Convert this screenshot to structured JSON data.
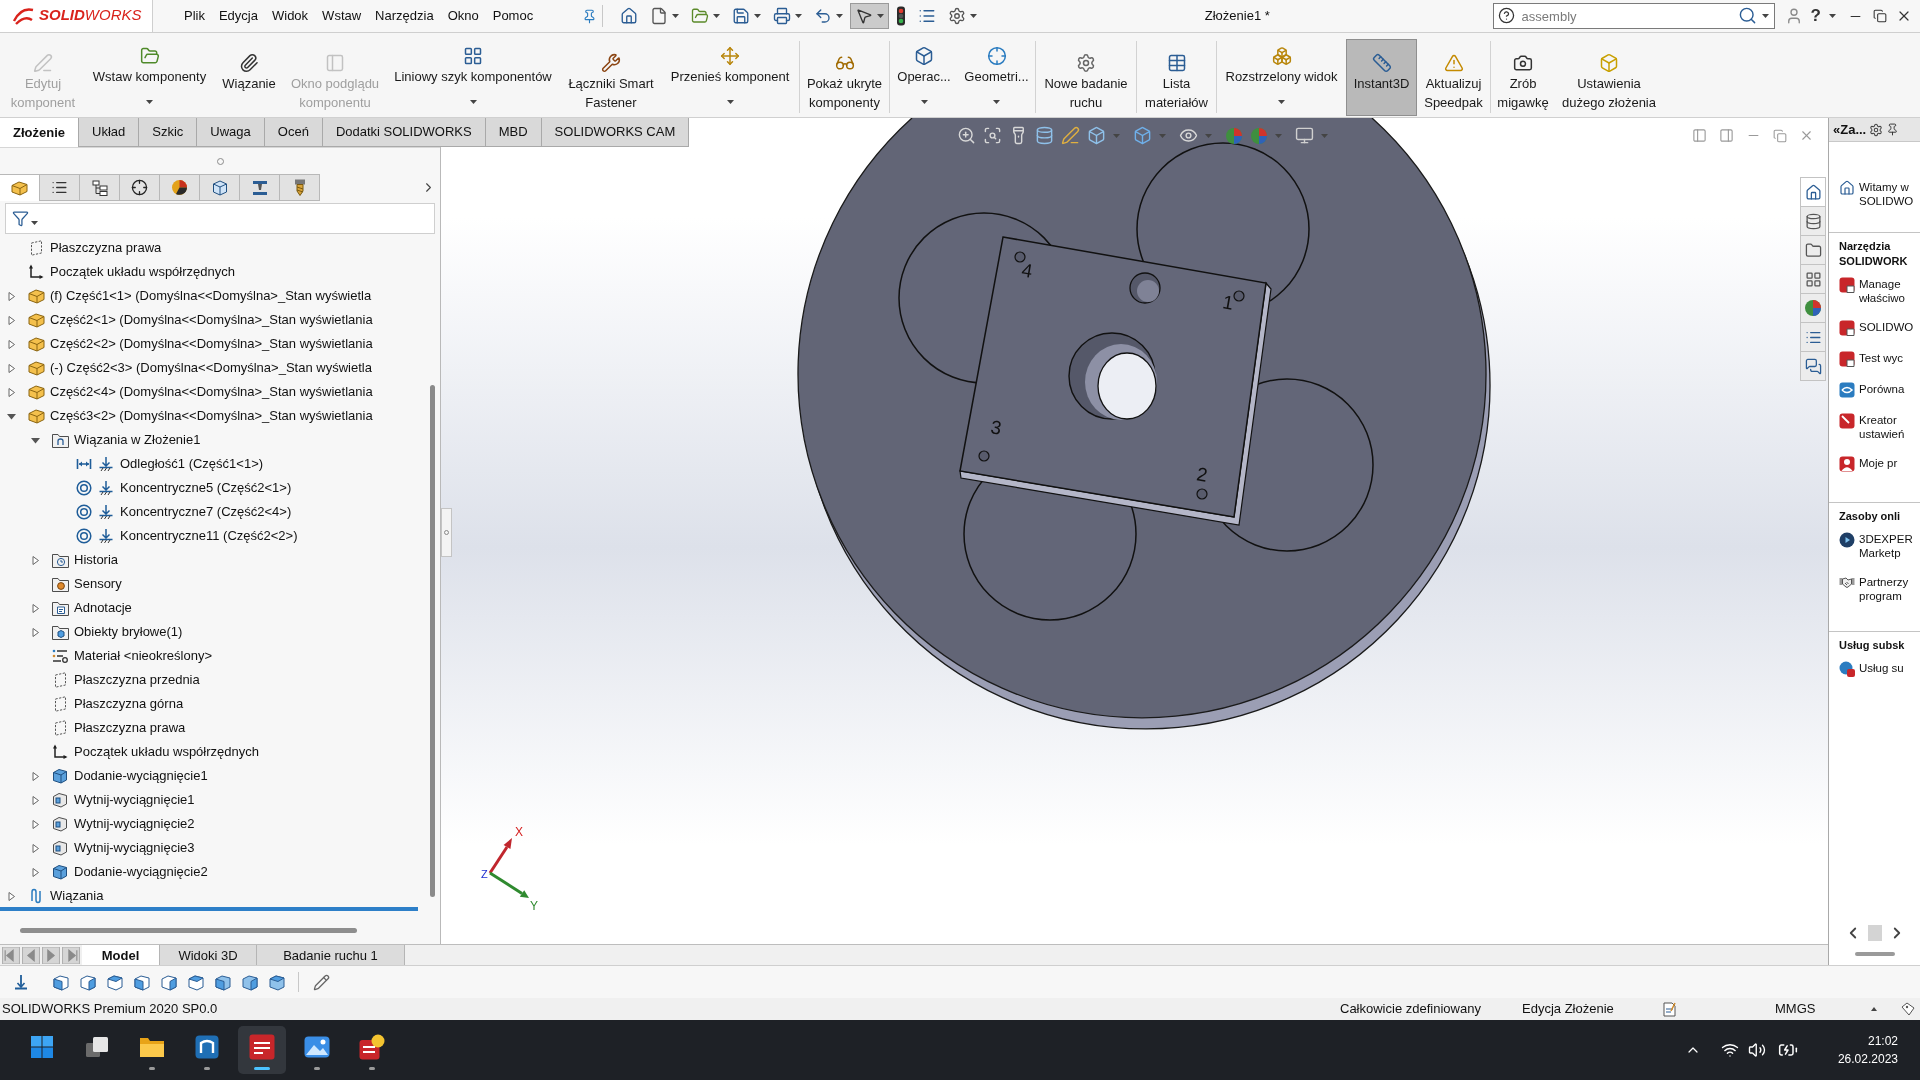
{
  "app": {
    "logo_text": "**SOLID**WORKS",
    "menu": [
      "Plik",
      "Edycja",
      "Widok",
      "Wstaw",
      "Narzędzia",
      "Okno",
      "Pomoc"
    ],
    "quick_access": [
      {
        "dropdown": false,
        "pressed": false
      },
      {
        "dropdown": true,
        "pressed": false
      },
      {
        "dropdown": true,
        "pressed": false
      },
      {
        "dropdown": true,
        "pressed": false
      },
      {
        "dropdown": true,
        "pressed": false
      },
      {
        "dropdown": true,
        "pressed": false
      },
      {
        "dropdown": true,
        "pressed": true
      },
      {
        "dropdown": false,
        "pressed": false
      },
      {
        "dropdown": false,
        "pressed": false
      },
      {
        "dropdown": true,
        "pressed": false
      }
    ],
    "title": "Złożenie1 *",
    "search": {
      "placeholder": "assembly"
    },
    "help_label": "?"
  },
  "ribbon": {
    "groups": [
      [
        {
          "label": "Edytuj komponent",
          "disabled": true,
          "dropdown": false,
          "on": false
        },
        {
          "label": "Wstaw komponenty",
          "disabled": false,
          "dropdown": true,
          "on": false
        },
        {
          "label": "Wiązanie",
          "disabled": false,
          "dropdown": false,
          "on": false
        },
        {
          "label": "Okno podglądu komponentu",
          "disabled": true,
          "dropdown": false,
          "on": false
        },
        {
          "label": "Liniowy szyk komponentów",
          "disabled": false,
          "dropdown": true,
          "on": false
        },
        {
          "label": "Łączniki Smart Fastener",
          "disabled": false,
          "dropdown": false,
          "on": false
        },
        {
          "label": "Przenieś komponent",
          "disabled": false,
          "dropdown": true,
          "on": false
        }
      ],
      [
        {
          "label": "Pokaż ukryte komponenty",
          "disabled": false,
          "dropdown": false,
          "on": false
        }
      ],
      [
        {
          "label": "Operac...",
          "disabled": false,
          "dropdown": true,
          "on": false
        },
        {
          "label": "Geometri...",
          "disabled": false,
          "dropdown": true,
          "on": false
        }
      ],
      [
        {
          "label": "Nowe badanie ruchu",
          "disabled": false,
          "dropdown": false,
          "on": false
        }
      ],
      [
        {
          "label": "Lista materiałów",
          "disabled": false,
          "dropdown": false,
          "on": false
        }
      ],
      [
        {
          "label": "Rozstrzelony widok",
          "disabled": false,
          "dropdown": true,
          "on": false
        },
        {
          "label": "Instant3D",
          "disabled": false,
          "dropdown": false,
          "on": true
        },
        {
          "label": "Aktualizuj Speedpak",
          "disabled": false,
          "dropdown": false,
          "on": false
        }
      ],
      [
        {
          "label": "Zrób migawkę",
          "disabled": false,
          "dropdown": false,
          "on": false
        },
        {
          "label": "Ustawienia dużego złożenia",
          "disabled": false,
          "dropdown": false,
          "on": false
        }
      ]
    ]
  },
  "command_tabs": [
    {
      "label": "Złożenie",
      "selected": true
    },
    {
      "label": "Układ",
      "selected": false
    },
    {
      "label": "Szkic",
      "selected": false
    },
    {
      "label": "Uwaga",
      "selected": false
    },
    {
      "label": "Oceń",
      "selected": false
    },
    {
      "label": "Dodatki SOLIDWORKS",
      "selected": false
    },
    {
      "label": "MBD",
      "selected": false
    },
    {
      "label": "SOLIDWORKS CAM",
      "selected": false
    }
  ],
  "feature_manager": {
    "panel_tabs": [
      {
        "selected": true
      },
      {
        "selected": false
      },
      {
        "selected": false
      },
      {
        "selected": false
      },
      {
        "selected": false
      },
      {
        "selected": false
      },
      {
        "selected": false
      },
      {
        "selected": false
      }
    ],
    "tree": [
      {
        "text": "Płaszczyzna prawa",
        "kind": "plane"
      },
      {
        "text": "Początek układu współrzędnych",
        "kind": "origin"
      },
      {
        "text": "(f) Część1<1> (Domyślna<<Domyślna>_Stan wyświetla",
        "kind": "part",
        "expanded": false
      },
      {
        "text": "Część2<1> (Domyślna<<Domyślna>_Stan wyświetlania",
        "kind": "part",
        "expanded": false
      },
      {
        "text": "Część2<2> (Domyślna<<Domyślna>_Stan wyświetlania",
        "kind": "part",
        "expanded": false
      },
      {
        "text": "(-) Część2<3> (Domyślna<<Domyślna>_Stan wyświetla",
        "kind": "part",
        "expanded": false
      },
      {
        "text": "Część2<4> (Domyślna<<Domyślna>_Stan wyświetlania",
        "kind": "part",
        "expanded": false
      },
      {
        "text": "Część3<2> (Domyślna<<Domyślna>_Stan wyświetlania",
        "kind": "part",
        "expanded": true,
        "children": [
          {
            "text": "Wiązania w Złożenie1",
            "kind": "mates_folder",
            "expanded": true,
            "children": [
              {
                "text": "Odległość1 (Część1<1>)",
                "kind": "distance_mate"
              },
              {
                "text": "Koncentryczne5 (Część2<1>)",
                "kind": "concentric_mate"
              },
              {
                "text": "Koncentryczne7 (Część2<4>)",
                "kind": "concentric_mate"
              },
              {
                "text": "Koncentryczne11 (Część2<2>)",
                "kind": "concentric_mate"
              }
            ]
          },
          {
            "text": "Historia",
            "kind": "history_folder",
            "expanded": false
          },
          {
            "text": "Sensory",
            "kind": "sensors_folder"
          },
          {
            "text": "Adnotacje",
            "kind": "annotations_folder",
            "expanded": false
          },
          {
            "text": "Obiekty bryłowe(1)",
            "kind": "bodies_folder",
            "expanded": false
          },
          {
            "text": "Materiał <nieokreślony>",
            "kind": "material"
          },
          {
            "text": "Płaszczyzna przednia",
            "kind": "plane"
          },
          {
            "text": "Płaszczyzna górna",
            "kind": "plane"
          },
          {
            "text": "Płaszczyzna prawa",
            "kind": "plane"
          },
          {
            "text": "Początek układu współrzędnych",
            "kind": "origin"
          },
          {
            "text": "Dodanie-wyciągnięcie1",
            "kind": "boss",
            "expanded": false
          },
          {
            "text": "Wytnij-wyciągnięcie1",
            "kind": "cut",
            "expanded": false
          },
          {
            "text": "Wytnij-wyciągnięcie2",
            "kind": "cut",
            "expanded": false
          },
          {
            "text": "Wytnij-wyciągnięcie3",
            "kind": "cut",
            "expanded": false
          },
          {
            "text": "Dodanie-wyciągnięcie2",
            "kind": "boss",
            "expanded": false
          }
        ]
      },
      {
        "text": "Wiązania",
        "kind": "mates",
        "expanded": false
      }
    ]
  },
  "viewport": {
    "plate_labels": [
      "4",
      "1",
      "3",
      "2"
    ],
    "triad_labels": [
      "X",
      "Y",
      "Z"
    ]
  },
  "task_pane": {
    "title": "«Za...",
    "tabs": [
      {
        "selected": true
      },
      {
        "selected": false
      },
      {
        "selected": false
      },
      {
        "selected": false
      },
      {
        "selected": false
      },
      {
        "selected": false
      },
      {
        "selected": false
      }
    ],
    "welcome": "Witamy w SOLIDWO",
    "sections": [
      {
        "title": "Narzędzia SOLIDWORK",
        "items": [
          "Manage właściwo",
          "SOLIDWO",
          "Test wyc",
          "Porówna",
          "Kreator ustawień",
          "Moje pr"
        ]
      },
      {
        "title": "Zasoby onli",
        "items": [
          "3DEXPER Marketp",
          "Partnerzy program"
        ]
      },
      {
        "title": "Usług subsk",
        "items": [
          "Usług su"
        ]
      }
    ]
  },
  "bottom_tabs": [
    {
      "label": "Model",
      "selected": true
    },
    {
      "label": "Widoki 3D",
      "selected": false
    },
    {
      "label": "Badanie ruchu 1",
      "selected": false
    }
  ],
  "status_bar": {
    "product": "SOLIDWORKS Premium 2020 SP0.0",
    "definition": "Całkowicie zdefiniowany",
    "mode": "Edycja Złożenie",
    "units": "MMGS"
  },
  "taskbar": {
    "apps": [
      {
        "running": false,
        "active": false
      },
      {
        "running": false,
        "active": false
      },
      {
        "running": true,
        "active": false
      },
      {
        "running": true,
        "active": false
      },
      {
        "running": true,
        "active": true
      },
      {
        "running": true,
        "active": false
      },
      {
        "running": true,
        "active": false
      }
    ],
    "time": "21:02",
    "date": "26.02.2023"
  }
}
